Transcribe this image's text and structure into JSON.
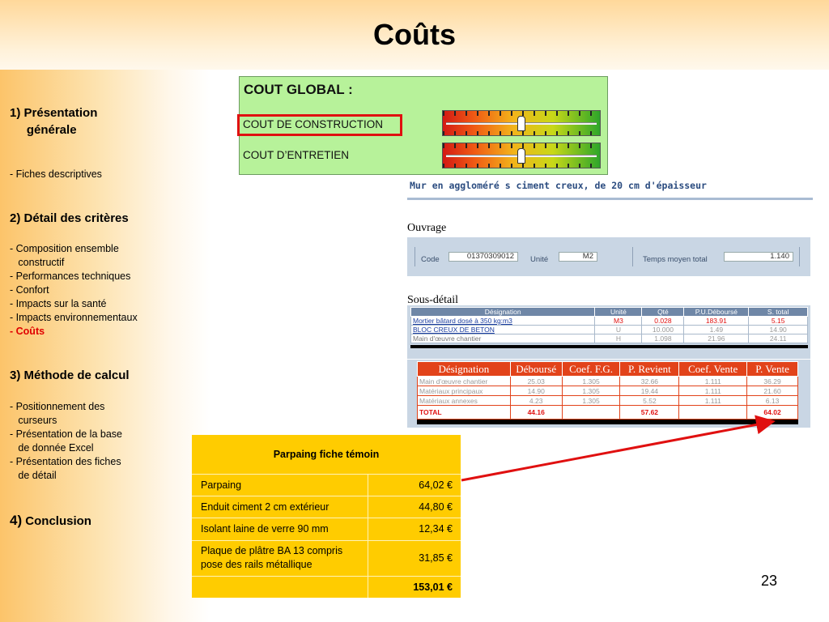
{
  "title": "Coûts",
  "page_number": "23",
  "sidebar": {
    "s1_heading": "1) Présentation\n     générale",
    "s1_item": "- Fiches descriptives",
    "s2_heading": "2) Détail des critères",
    "s2_items": "- Composition ensemble\n   constructif\n- Performances techniques\n- Confort\n- Impacts sur la santé\n- Impacts environnementaux",
    "s2_active_prefix": "- ",
    "s2_active": "Coûts",
    "s3_heading": "3) Méthode de calcul",
    "s3_items": "- Positionnement des\n   curseurs\n- Présentation de la base\n   de donnée Excel\n- Présentation des fiches\n   de détail",
    "s4_number": "4)",
    "s4_label": "Conclusion"
  },
  "cout_global": {
    "title": "COUT GLOBAL :",
    "construction_label": "COUT DE CONSTRUCTION",
    "entretien_label": "COUT D’ENTRETIEN",
    "construction_slider_fraction": 0.5,
    "entretien_slider_fraction": 0.5
  },
  "ouvrage": {
    "heading": "Mur en aggloméré s ciment creux, de 20 cm d'épaisseur",
    "section_label": "Ouvrage",
    "code_label": "Code",
    "code_value": "01370309012",
    "unite_label": "Unité",
    "unite_value": "M2",
    "temps_label": "Temps moyen total",
    "temps_value": "1.140"
  },
  "sous_detail": {
    "section_label": "Sous-détail",
    "headers": [
      "Désignation",
      "Unité",
      "Qté",
      "P.U.Déboursé",
      "S. total"
    ],
    "rows": [
      [
        "Mortier bâtard dosé à 350 kg:m3",
        "M3",
        "0.028",
        "183.91",
        "5.15"
      ],
      [
        "BLOC CREUX DE BETON",
        "U",
        "10.000",
        "1.49",
        "14.90"
      ],
      [
        "Main d'œuvre chantier",
        "H",
        "1.098",
        "21.96",
        "24.11"
      ]
    ]
  },
  "prix_detail": {
    "headers": [
      "Désignation",
      "Déboursé",
      "Coef. F.G.",
      "P. Revient",
      "Coef. Vente",
      "P. Vente"
    ],
    "rows": [
      [
        "Main d'œuvre chantier",
        "25.03",
        "1.305",
        "32.66",
        "1.111",
        "36.29"
      ],
      [
        "Matériaux  principaux",
        "14.90",
        "1.305",
        "19.44",
        "1.111",
        "21.60"
      ],
      [
        "Matériaux  annexes",
        "4.23",
        "1.305",
        "5.52",
        "1.111",
        "6.13"
      ]
    ],
    "total": [
      "TOTAL",
      "44.16",
      "",
      "57.62",
      "",
      "64.02"
    ]
  },
  "parpaing": {
    "title": "Parpaing fiche témoin",
    "rows": [
      {
        "label": "Parpaing",
        "value": "64,02 €"
      },
      {
        "label": "Enduit ciment 2 cm extérieur",
        "value": "44,80 €"
      },
      {
        "label": "Isolant  laine de verre 90 mm",
        "value": "12,34 €"
      },
      {
        "label": "Plaque de plâtre BA 13 compris\npose des rails métallique",
        "value": "31,85 €"
      }
    ],
    "total": "153,01 €"
  },
  "colors": {
    "accent_red": "#e01010",
    "green_box": "#b7f29a",
    "parpaing_yellow": "#ffcc00",
    "table_header_orange": "#e2431a",
    "table_header_blue": "#6f87a7"
  }
}
